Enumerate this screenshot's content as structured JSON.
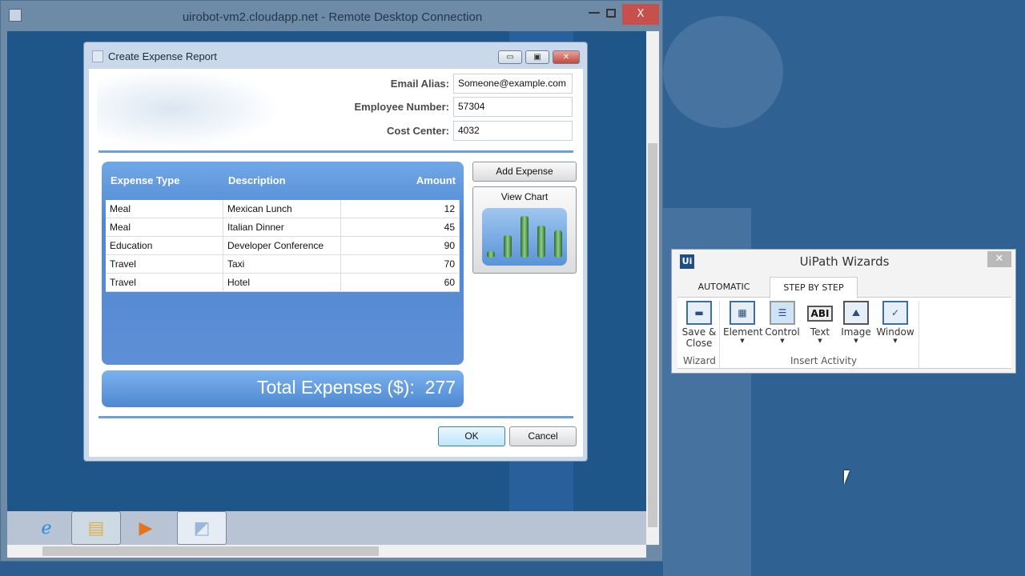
{
  "rdp": {
    "title": "uirobot-vm2.cloudapp.net - Remote Desktop Connection",
    "close": "X"
  },
  "dialog": {
    "title": "Create Expense Report",
    "fields": [
      {
        "label": "Email Alias:",
        "value": "Someone@example.com"
      },
      {
        "label": "Employee Number:",
        "value": "57304"
      },
      {
        "label": "Cost Center:",
        "value": "4032"
      }
    ],
    "table": {
      "headers": [
        "Expense Type",
        "Description",
        "Amount"
      ],
      "rows": [
        [
          "Meal",
          "Mexican Lunch",
          "12"
        ],
        [
          "Meal",
          "Italian Dinner",
          "45"
        ],
        [
          "Education",
          "Developer Conference",
          "90"
        ],
        [
          "Travel",
          "Taxi",
          "70"
        ],
        [
          "Travel",
          "Hotel",
          "60"
        ]
      ]
    },
    "total_label": "Total Expenses ($):",
    "total_value": "277",
    "add_expense": "Add Expense",
    "view_chart": "View Chart",
    "ok": "OK",
    "cancel": "Cancel"
  },
  "uipath": {
    "title": "UiPath Wizards",
    "logo": "Ui",
    "tabs": [
      {
        "label": "AUTOMATIC",
        "active": false
      },
      {
        "label": "STEP BY STEP",
        "active": true
      }
    ],
    "buttons": [
      {
        "label": "Save & Close",
        "icon": "floppy-disk-icon"
      },
      {
        "label": "Element",
        "icon": "element-grid-icon"
      },
      {
        "label": "Control",
        "icon": "control-list-icon"
      },
      {
        "label": "Text",
        "icon": "text-abi-icon",
        "glyph": "ABI"
      },
      {
        "label": "Image",
        "icon": "image-icon"
      },
      {
        "label": "Window",
        "icon": "window-icon"
      }
    ],
    "groups": [
      "Wizard",
      "Insert Activity"
    ]
  }
}
